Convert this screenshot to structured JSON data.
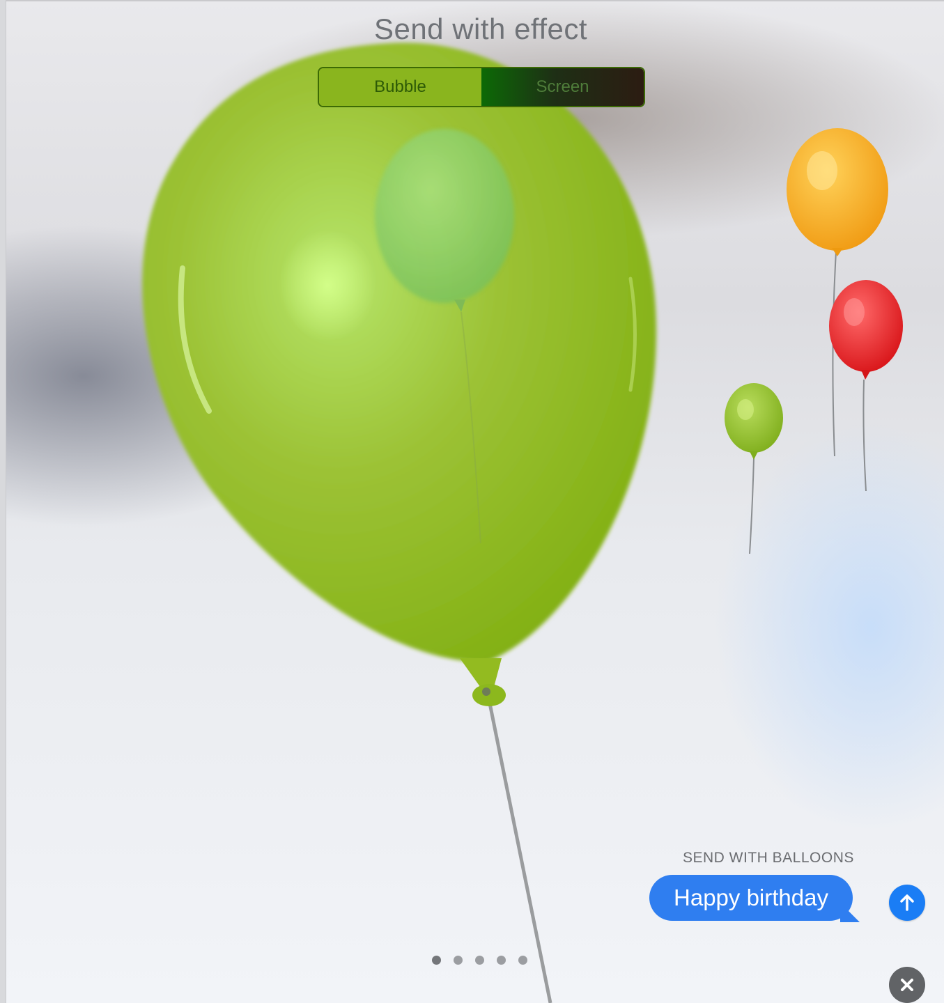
{
  "header": {
    "title": "Send with effect",
    "tabs": [
      {
        "label": "Bubble",
        "selected": true
      },
      {
        "label": "Screen",
        "selected": false
      }
    ]
  },
  "effect": {
    "name": "balloons",
    "caption": "SEND WITH BALLOONS",
    "balloon_colors": [
      "#8ab51e",
      "#f5a51c",
      "#e81e22",
      "#8ab51e",
      "#8fd46a"
    ]
  },
  "message": {
    "text": "Happy birthday",
    "bubble_color": "#2f7ef0"
  },
  "controls": {
    "send_icon": "arrow-up-icon",
    "close_icon": "close-icon"
  },
  "pager": {
    "count": 5,
    "current": 1
  }
}
